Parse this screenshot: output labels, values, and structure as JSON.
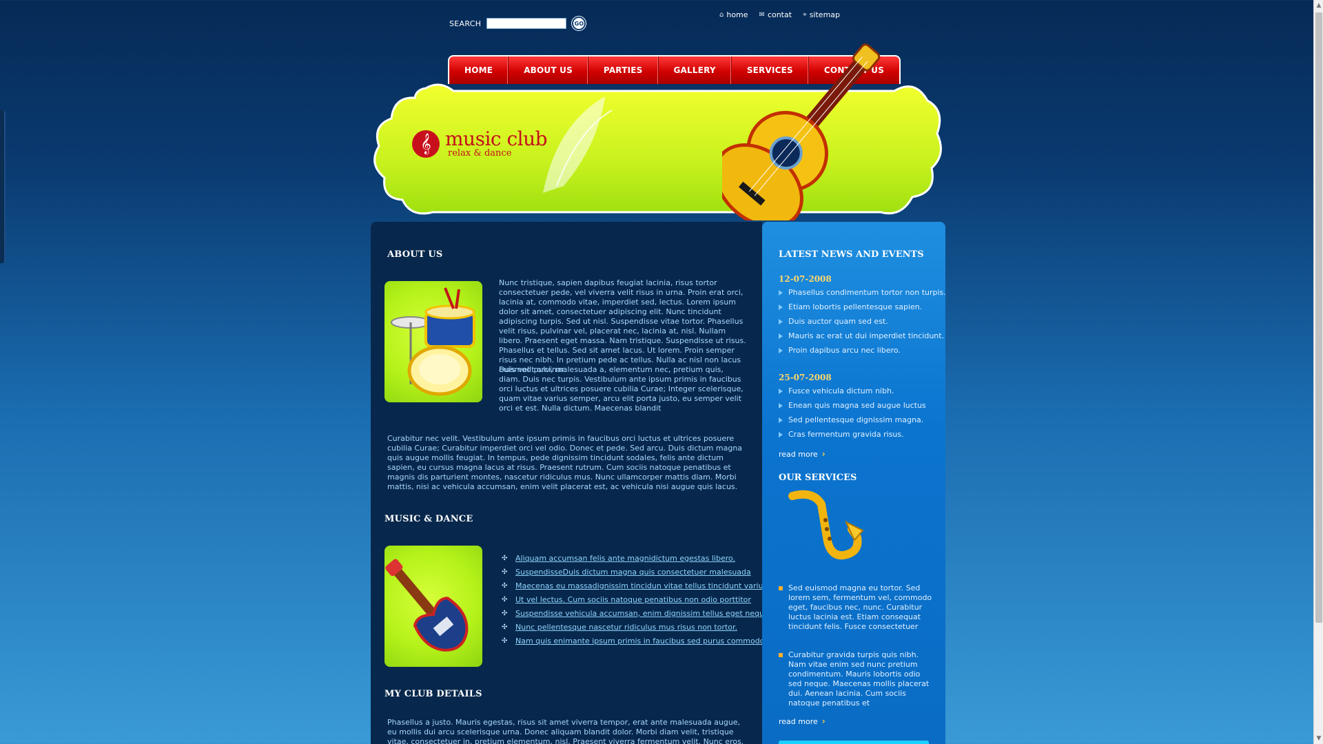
{
  "search": {
    "label": "SEARCH",
    "placeholder": "",
    "button": "GO"
  },
  "toplinks": [
    {
      "label": "home",
      "icon": "home-icon"
    },
    {
      "label": "contat",
      "icon": "mail-icon"
    },
    {
      "label": "sitemap",
      "icon": "sitemap-icon"
    }
  ],
  "nav": [
    "HOME",
    "ABOUT US",
    "PARTIES",
    "GALLERY",
    "SERVICES",
    "CONTACT US"
  ],
  "logo": {
    "name": "music club",
    "tagline": "relax & dance",
    "icon": "treble-clef-icon"
  },
  "colors": {
    "accent_red": "#c4101c",
    "lime": "#c8f52a",
    "dark_navy": "#07284c",
    "side_blue": "#0b74cf",
    "link_blue": "#8fd4ff"
  },
  "about": {
    "title": "ABOUT US",
    "p1": "Nunc tristique, sapien dapibus feugiat lacinia, risus tortor consectetuer pede, vel viverra velit risus in urna. Proin erat orci, lacinia at, commodo vitae, imperdiet sed, lectus. Lorem ipsum dolor sit amet, consectetuer adipiscing elit. Nunc tincidunt adipiscing turpis. Sed ut nisl. Suspendisse vitae tortor. Phasellus velit risus, pulvinar vel, placerat nec, lacinia at, nisl. Nullam libero. Praesent eget massa. Nam tristique. Suspendisse ut risus. Phasellus et tellus. Sed sit amet lacus. Ut lorem. Proin semper risus nec nibh. In pretium pede ac tellus. Nulla ac nisl non lacus euismod pulvinar.",
    "p2": "Duis velit orci, malesuada a, elementum nec, pretium quis, diam. Duis nec turpis. Vestibulum ante ipsum primis in faucibus orci luctus et ultrices posuere cubilia Curae; Integer scelerisque, quam vitae varius semper, arcu elit porta justo, eu semper velit orci et est. Nulla dictum. Maecenas blandit",
    "p3": "Curabitur nec velit. Vestibulum ante ipsum primis in faucibus orci luctus et ultrices posuere cubilia Curae; Curabitur imperdiet orci vel odio. Donec et pede. Sed arcu. Duis dictum magna quis augue mollis feugiat. In tempus, pede dignissim tincidunt sodales, felis ante dictum sapien, eu cursus magna lacus at risus. Praesent rutrum. Cum sociis natoque penatibus et magnis dis parturient montes, nascetur ridiculus mus. Nunc ullamcorper mattis diam. Morbi mattis, nisi ac vehicula accumsan, enim velit placerat est, ac vehicula nisi augue quis lacus."
  },
  "music": {
    "title": "MUSIC & DANCE",
    "links": [
      "Aliquam accumsan felis ante magnidictum egestas libero.",
      "SuspendisseDuis dictum magna quis consectetuer malesuada",
      "Maecenas eu massadignissim tincidun vitae tellus tincidunt varius.",
      "Ut vel lectus. Cum sociis natoque penatibus non odio porttitor",
      "Suspendisse vehicula accumsan, enim dignissim tellus eget neque.",
      "Nunc pellentesque nascetur ridiculus mus risus non tortor.",
      "Nam quis enimante ipsum primis in faucibus sed purus commodo"
    ]
  },
  "club": {
    "title": "MY CLUB DETAILS",
    "text": "Phasellus a justo. Mauris egestas, risus sit amet viverra tempor, erat ante malesuada augue, eu mollis dui arcu scelerisque urna. Donec aliquam blandit dolor. Morbi diam velit, tristique vitae, consectetuer in, pretium elementum, nisl. Praesent viverra fermentum velit. Nunc eros. Pellentesque habitant morbi"
  },
  "sidebar": {
    "news_title": "LATEST NEWS AND EVENTS",
    "groups": [
      {
        "date": "12-07-2008",
        "items": [
          "Phasellus condimentum tortor non turpis.",
          "Etiam lobortis pellentesque sapien.",
          "Duis auctor quam sed est.",
          "Mauris ac erat ut dui imperdiet tincidunt.",
          "Proin dapibus arcu nec libero."
        ]
      },
      {
        "date": "25-07-2008",
        "items": [
          "Fusce vehicula dictum nibh.",
          "Enean quis magna sed augue luctus",
          "Sed pellentesque dignissim magna.",
          "Cras fermentum gravida risus."
        ]
      }
    ],
    "read_more": "read more",
    "services_title": "OUR SERVICES",
    "services": [
      "Sed euismod magna eu tortor. Sed lorem sem, fermentum vel, commodo eget, faucibus nec, nunc. Curabitur luctus lacinia est. Etiam consequat tincidunt felis. Fusce consectetuer",
      "Curabitur gravida turpis quis nibh. Nam vitae enim sed nunc pretium condimentum. Mauris lobortis odio sed neque. Maecenas mollis placerat dui. Aenean lacinia. Cum sociis natoque penatibus et"
    ]
  }
}
